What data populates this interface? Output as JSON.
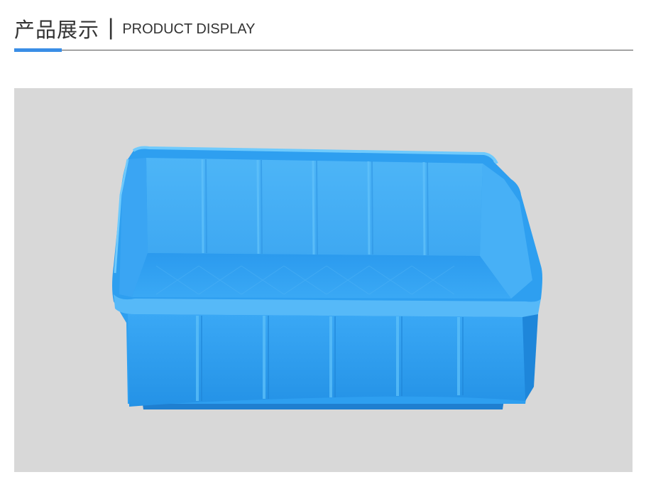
{
  "header": {
    "title_cn": "产品展示",
    "separator": "|",
    "title_en": "PRODUCT DISPLAY"
  },
  "colors": {
    "accent": "#3a8ee6",
    "rule": "#555555",
    "photo_background": "#d8d8d8",
    "crate_blue": "#2a9ff0"
  },
  "photo": {
    "subject": "blue-plastic-storage-crate"
  }
}
